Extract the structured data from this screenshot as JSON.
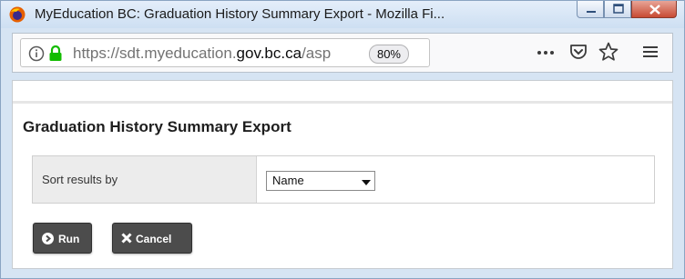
{
  "window": {
    "title": "MyEducation BC: Graduation History Summary Export - Mozilla Fi..."
  },
  "urlbar": {
    "url_prefix": "https://sdt.myeducation.",
    "url_domain": "gov.bc.ca",
    "url_suffix": "/asp",
    "zoom": "80%"
  },
  "page": {
    "title": "Graduation History Summary Export"
  },
  "form": {
    "sort_label": "Sort results by",
    "sort_value": "Name"
  },
  "buttons": {
    "run": "Run",
    "cancel": "Cancel"
  },
  "colors": {
    "button_bg": "#4c4c4c",
    "lock": "#12bc00",
    "firefox_orange": "#e66000"
  }
}
